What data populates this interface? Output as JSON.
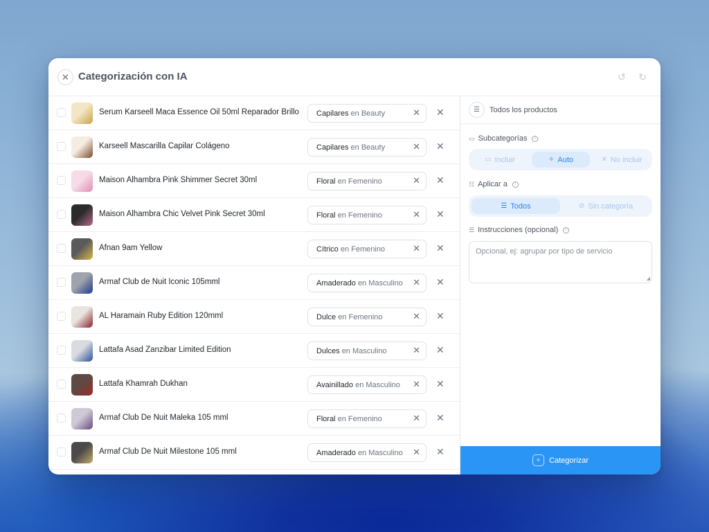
{
  "dialog": {
    "title": "Categorización con IA",
    "close_icon": "close-icon",
    "undo_icon": "undo-icon",
    "redo_icon": "redo-icon"
  },
  "products": [
    {
      "name": "Serum Karseell Maca Essence Oil 50ml Reparador Brillo",
      "category": "Capilares",
      "parent": "en Beauty",
      "thumb_colors": [
        "#f3e6c4",
        "#c9a24a"
      ]
    },
    {
      "name": "Karseell Mascarilla Capilar Colágeno",
      "category": "Capilares",
      "parent": "en Beauty",
      "thumb_colors": [
        "#f5ece2",
        "#7a4a2b"
      ]
    },
    {
      "name": "Maison Alhambra Pink Shimmer Secret 30ml",
      "category": "Floral",
      "parent": "en Femenino",
      "thumb_colors": [
        "#f7dce8",
        "#e28bb3"
      ]
    },
    {
      "name": "Maison Alhambra Chic Velvet Pink Secret 30ml",
      "category": "Floral",
      "parent": "en Femenino",
      "thumb_colors": [
        "#2b2b2b",
        "#b86a8a"
      ]
    },
    {
      "name": "Afnan 9am Yellow",
      "category": "Cítrico",
      "parent": "en Femenino",
      "thumb_colors": [
        "#5a5a5a",
        "#d9b64a"
      ]
    },
    {
      "name": "Armaf Club de Nuit Iconic 105mml",
      "category": "Amaderado",
      "parent": "en Masculino",
      "thumb_colors": [
        "#9fa3ab",
        "#1d3b8f"
      ]
    },
    {
      "name": "AL Haramain Ruby Edition 120mml",
      "category": "Dulce",
      "parent": "en Femenino",
      "thumb_colors": [
        "#e9e4df",
        "#8a1f2a"
      ]
    },
    {
      "name": "Lattafa Asad Zanzibar Limited Edition",
      "category": "Dulces",
      "parent": "en Masculino",
      "thumb_colors": [
        "#d8dbe0",
        "#2c4e9a"
      ]
    },
    {
      "name": "Lattafa Khamrah Dukhan",
      "category": "Avainillado",
      "parent": "en Masculino",
      "thumb_colors": [
        "#5e4a44",
        "#9a2a2a"
      ]
    },
    {
      "name": "Armaf Club De Nuit Maleka 105 mml",
      "category": "Floral",
      "parent": "en Femenino",
      "thumb_colors": [
        "#cfc9d6",
        "#6a4a7e"
      ]
    },
    {
      "name": "Armaf Club De Nuit Milestone 105 mml",
      "category": "Amaderado",
      "parent": "en Masculino",
      "thumb_colors": [
        "#4a4a4a",
        "#c7a86a"
      ]
    }
  ],
  "panel": {
    "scope_label": "Todos los productos",
    "subcategorias": {
      "label": "Subcategorías",
      "options": [
        "Incluir",
        "Auto",
        "No incluir"
      ],
      "selected": "Auto"
    },
    "aplicar": {
      "label": "Aplicar a",
      "options": [
        "Todos",
        "Sin categoría"
      ],
      "selected": "Todos"
    },
    "instrucciones": {
      "label": "Instrucciones (opcional)",
      "placeholder": "Opcional, ej: agrupar por tipo de servicio"
    },
    "cta_label": "Categorizar"
  },
  "colors": {
    "accent": "#2b95f5",
    "segment_active_text": "#2f80ed",
    "segment_bg": "#eef4fc"
  }
}
